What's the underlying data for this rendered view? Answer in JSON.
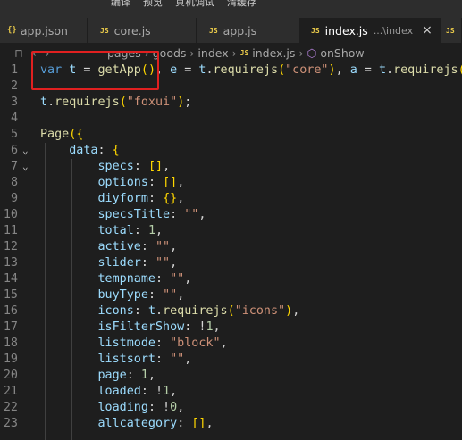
{
  "menubar": {
    "items": [
      "编译",
      "预览",
      "真机调试",
      "清缓存"
    ]
  },
  "tabs": [
    {
      "label": "app.json",
      "icon": "json-icon"
    },
    {
      "label": "core.js",
      "icon": "js-icon"
    },
    {
      "label": "app.js",
      "icon": "js-icon"
    },
    {
      "label": "index.js",
      "path": "...\\index",
      "icon": "js-icon",
      "active": true,
      "close": "×"
    }
  ],
  "breadcrumb": [
    "pages",
    "goods",
    "index",
    "index.js",
    "onShow"
  ],
  "code_lines": [
    {
      "n": "1",
      "code": "var t = getApp(), e = t.requirejs(\"core\"), a = t.requirejs(\"jo"
    },
    {
      "n": "2",
      "code": ""
    },
    {
      "n": "3",
      "code": "t.requirejs(\"foxui\");"
    },
    {
      "n": "4",
      "code": ""
    },
    {
      "n": "5",
      "code": "Page({"
    },
    {
      "n": "6",
      "code": "    data: {"
    },
    {
      "n": "7",
      "code": "        specs: [],"
    },
    {
      "n": "8",
      "code": "        options: [],"
    },
    {
      "n": "9",
      "code": "        diyform: {},"
    },
    {
      "n": "10",
      "code": "        specsTitle: \"\","
    },
    {
      "n": "11",
      "code": "        total: 1,"
    },
    {
      "n": "12",
      "code": "        active: \"\","
    },
    {
      "n": "13",
      "code": "        slider: \"\","
    },
    {
      "n": "14",
      "code": "        tempname: \"\","
    },
    {
      "n": "15",
      "code": "        buyType: \"\","
    },
    {
      "n": "16",
      "code": "        icons: t.requirejs(\"icons\"),"
    },
    {
      "n": "17",
      "code": "        isFilterShow: !1,"
    },
    {
      "n": "18",
      "code": "        listmode: \"block\","
    },
    {
      "n": "19",
      "code": "        listsort: \"\","
    },
    {
      "n": "20",
      "code": "        page: 1,"
    },
    {
      "n": "21",
      "code": "        loaded: !1,"
    },
    {
      "n": "22",
      "code": "        loading: !0,"
    },
    {
      "n": "23",
      "code": "        allcategory: [],"
    }
  ]
}
